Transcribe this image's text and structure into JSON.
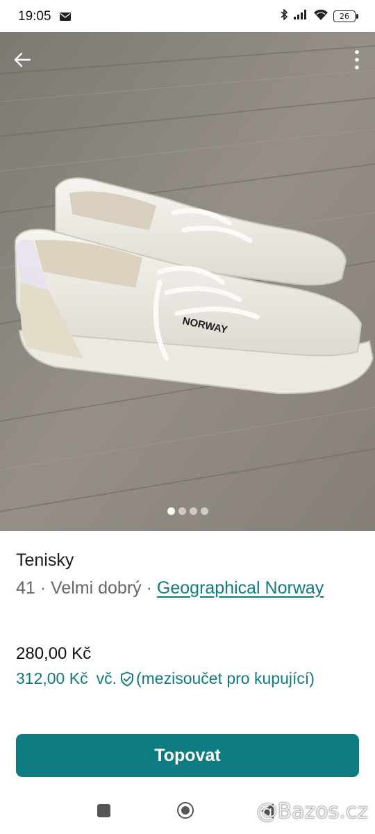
{
  "status_bar": {
    "time": "19:05",
    "battery": "26",
    "icons": [
      "mail-icon",
      "bluetooth-icon",
      "signal-icon",
      "wifi-icon",
      "battery-icon"
    ]
  },
  "gallery": {
    "image_count": 4,
    "active_index": 0,
    "back_icon": "arrow-left-icon",
    "menu_icon": "more-vertical-icon"
  },
  "listing": {
    "title": "Tenisky",
    "size": "41",
    "separator": "·",
    "condition": "Velmi dobrý",
    "brand": "Geographical Norway",
    "price": "280,00 Kč",
    "buyer_price": "312,00 Kč",
    "buyer_price_suffix": "vč.",
    "buyer_price_note": "(mezisoučet pro kupující)",
    "shield_icon": "shield-check-icon"
  },
  "actions": {
    "promote_label": "Topovat"
  },
  "watermark": "@Bazos.cz",
  "colors": {
    "accent": "#0f7b82",
    "text": "#1a1a1a",
    "muted": "#666666"
  }
}
